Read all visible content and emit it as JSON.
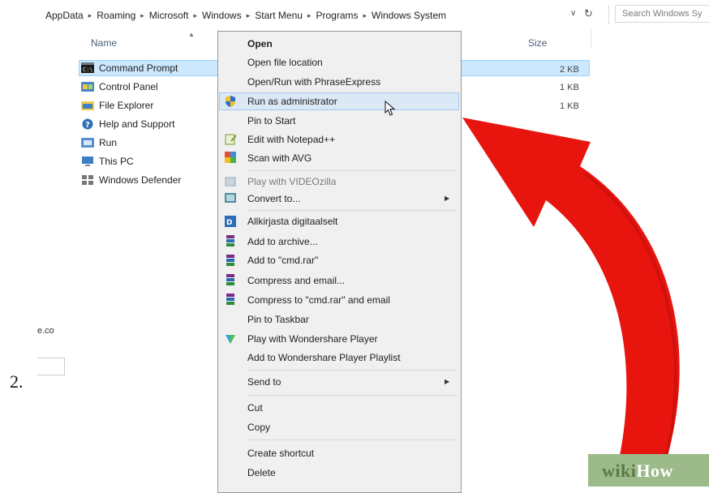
{
  "breadcrumb": [
    "AppData",
    "Roaming",
    "Microsoft",
    "Windows",
    "Start Menu",
    "Programs",
    "Windows System"
  ],
  "search": {
    "placeholder": "Search Windows Sy"
  },
  "columns": {
    "name": "Name",
    "size": "Size"
  },
  "files": [
    {
      "name": "Command Prompt",
      "icon": "command-prompt-icon",
      "size": "2 KB",
      "selected": true
    },
    {
      "name": "Control Panel",
      "icon": "control-panel-icon",
      "size": "1 KB"
    },
    {
      "name": "File Explorer",
      "icon": "file-explorer-icon",
      "size": "1 KB"
    },
    {
      "name": "Help and Support",
      "icon": "help-icon"
    },
    {
      "name": "Run",
      "icon": "run-icon"
    },
    {
      "name": "This PC",
      "icon": "this-pc-icon"
    },
    {
      "name": "Windows Defender",
      "icon": "windows-defender-icon"
    }
  ],
  "context_menu": {
    "items": [
      {
        "label": "Open",
        "bold": true
      },
      {
        "label": "Open file location"
      },
      {
        "label": "Open/Run with PhraseExpress"
      },
      {
        "label": "Run as administrator",
        "icon": "uac-shield-icon",
        "highlighted": true
      },
      {
        "label": "Pin to Start"
      },
      {
        "label": "Edit with Notepad++",
        "icon": "notepad-plus-plus-icon"
      },
      {
        "label": "Scan with AVG",
        "icon": "avg-icon"
      },
      {
        "label": "Play with VIDEOzilla",
        "icon": "videozilla-icon",
        "disabled": true
      },
      {
        "label": "Convert to...",
        "icon": "convert-icon",
        "submenu": true
      },
      {
        "label": "Allkirjasta digitaalselt",
        "icon": "digital-signature-icon"
      },
      {
        "label": "Add to archive...",
        "icon": "winrar-icon"
      },
      {
        "label": "Add to \"cmd.rar\"",
        "icon": "winrar-icon"
      },
      {
        "label": "Compress and email...",
        "icon": "winrar-icon"
      },
      {
        "label": "Compress to \"cmd.rar\" and email",
        "icon": "winrar-icon"
      },
      {
        "label": "Pin to Taskbar"
      },
      {
        "label": "Play with Wondershare Player",
        "icon": "wondershare-icon"
      },
      {
        "label": "Add to Wondershare Player Playlist"
      },
      {
        "label": "Send to",
        "submenu": true
      },
      {
        "label": "Cut"
      },
      {
        "label": "Copy"
      },
      {
        "label": "Create shortcut"
      },
      {
        "label": "Delete"
      }
    ]
  },
  "left_fragment": {
    "text": "e.co"
  },
  "step_number": "2.",
  "watermark": {
    "part1": "wiki",
    "part2": "How"
  },
  "colors": {
    "accent_arrow": "#e8150f",
    "selection": "#cce8ff",
    "menu_hover": "#dbe9f7",
    "wikihow_green": "#9cba8a"
  }
}
